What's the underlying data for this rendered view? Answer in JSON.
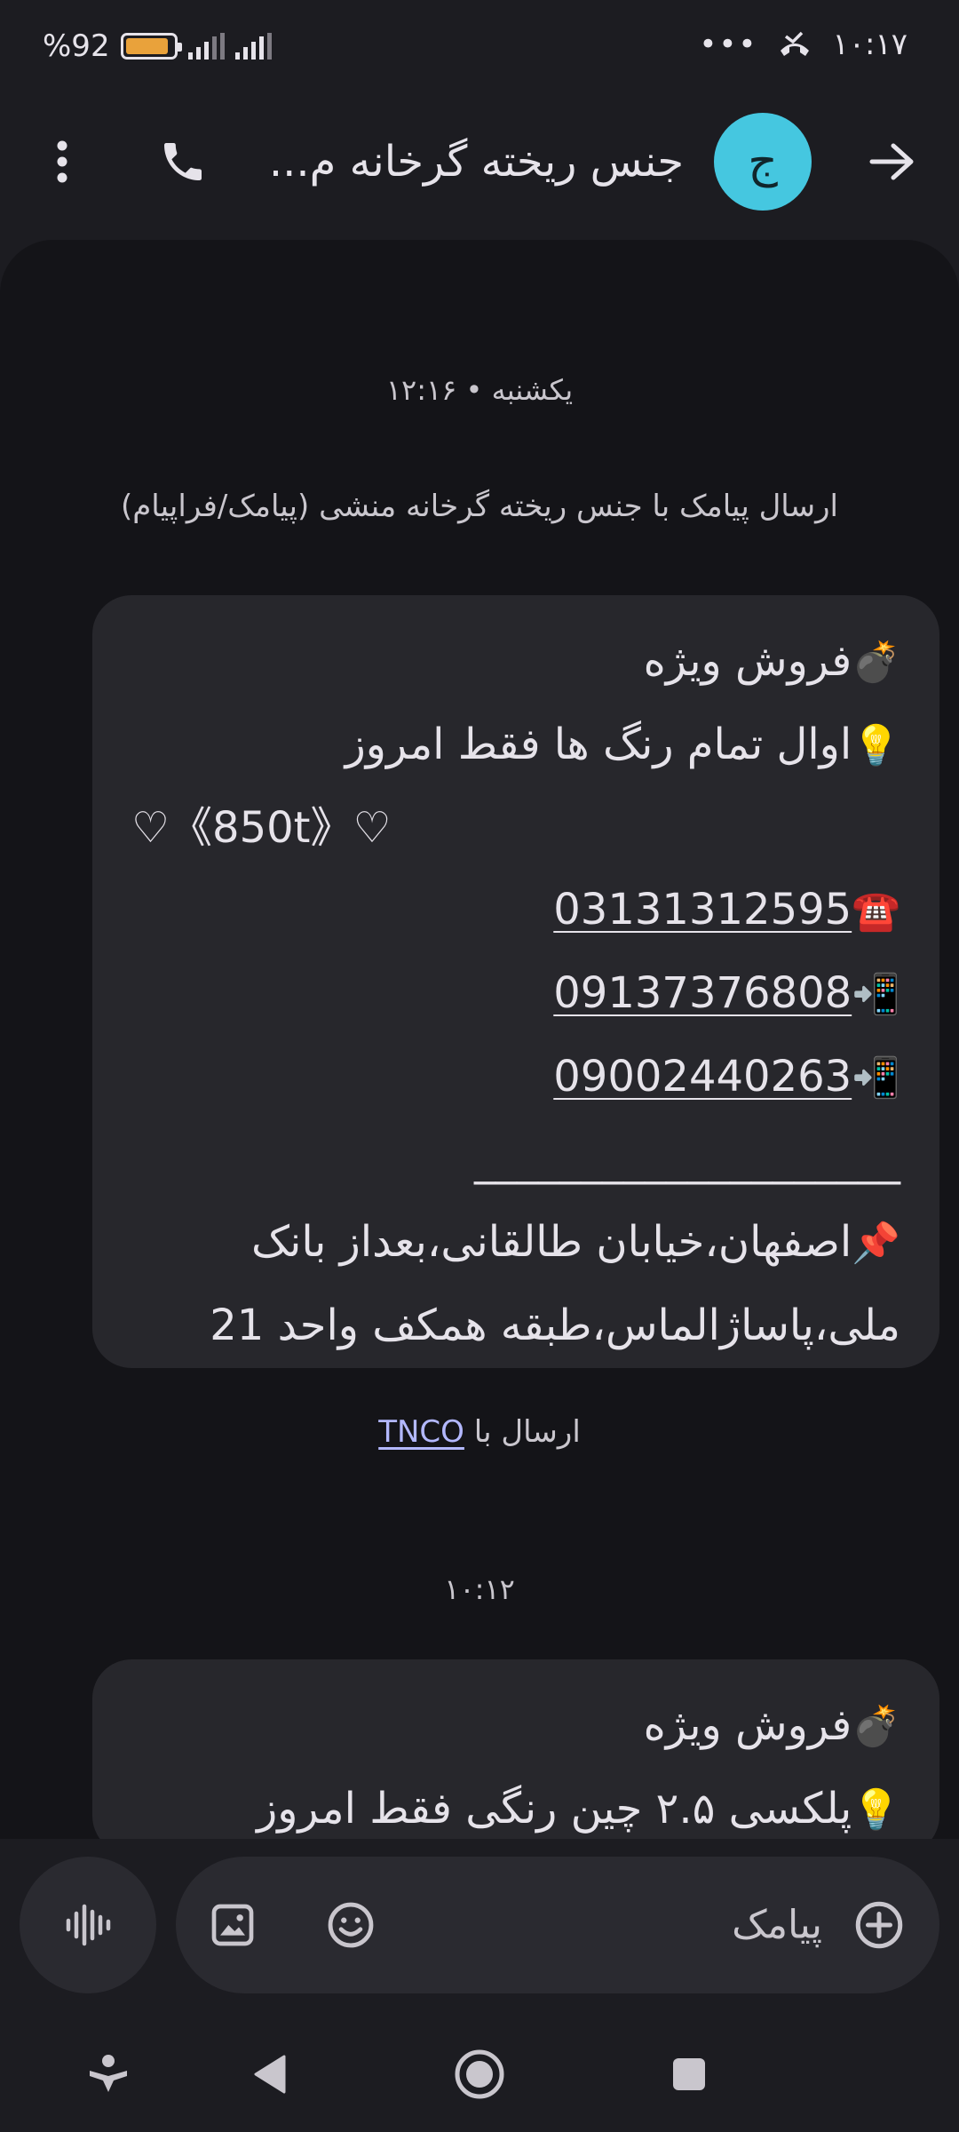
{
  "status_bar": {
    "battery_text": "%92",
    "battery_level": 0.92,
    "time": "۱۰:۱۷",
    "overflow_dots": "•••"
  },
  "header": {
    "avatar_letter": "ج",
    "contact_name": "جنس ریخته گرخانه م..."
  },
  "conversation": {
    "date_separator": "یکشنبه • ۱۲:۱۶",
    "sim_info": "ارسال پیامک با جنس ریخته گرخانه منشی (پیامک/فراپیام)",
    "message_1": {
      "line_1_emoji": "💣",
      "line_1_text": "فروش ویژه",
      "line_2_emoji": "💡",
      "line_2_text": "اوال تمام رنگ ها فقط امروز",
      "line_3_text": "♡《850t》♡",
      "phone_1_emoji": "☎️",
      "phone_1": "03131312595",
      "phone_2_emoji": "📲",
      "phone_2": "09137376808",
      "phone_3_emoji": "📲",
      "phone_3": "09002440263",
      "divider": "____________________",
      "address_emoji": "📌",
      "address_line_1": "اصفهان،خیابان طالقانی،بعداز بانک",
      "address_line_2": "ملی،پاساژالماس،طبقه همکف واحد 21"
    },
    "sent_via_label": "ارسال با",
    "sent_via_link": "TNCO",
    "time_separator": "۱۰:۱۲",
    "message_2": {
      "line_1_emoji": "💣",
      "line_1_text": "فروش ویژه",
      "line_2_emoji": "💡",
      "line_2_text": "پلکسی ۲.۵ چین رنگی فقط امروز"
    }
  },
  "composer": {
    "placeholder": "پیامک"
  },
  "colors": {
    "background": "#1c1c21",
    "panel": "#141418",
    "bubble": "#27272c",
    "avatar": "#45c7e0",
    "battery": "#e9a23b",
    "link": "#b3b8ff"
  },
  "icons": {
    "back": "arrow-right-icon",
    "call": "phone-icon",
    "more": "more-vertical-icon",
    "voice": "voice-waveform-icon",
    "gallery": "image-icon",
    "emoji": "smiley-icon",
    "add": "plus-circle-icon",
    "nav": [
      "accessibility-icon",
      "back-triangle-icon",
      "home-circle-icon",
      "recents-square-icon"
    ]
  }
}
